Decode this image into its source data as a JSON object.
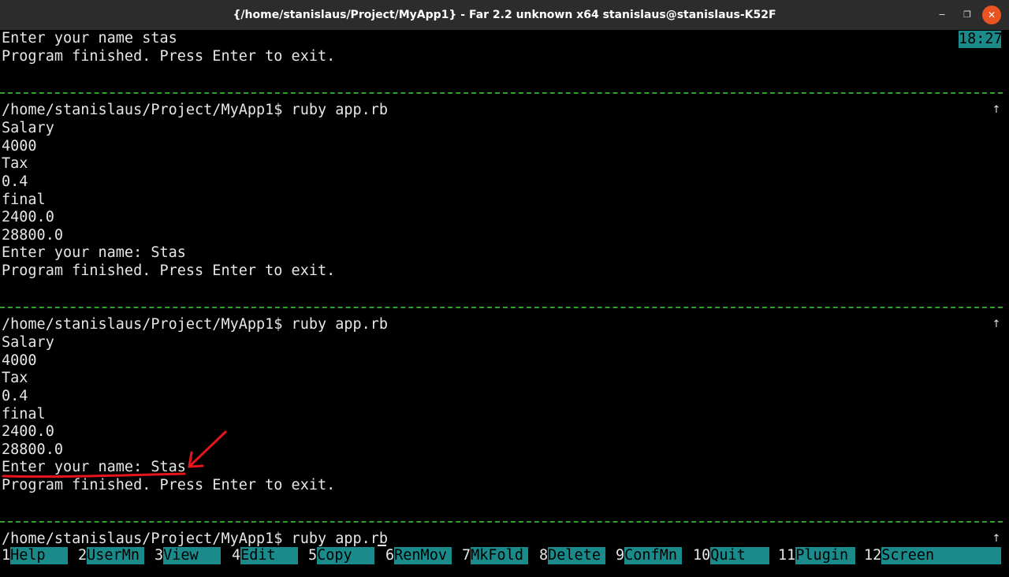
{
  "window": {
    "title": "{/home/stanislaus/Project/MyApp1} - Far 2.2 unknown x64 stanislaus@stanislaus-K52F",
    "minimize_glyph": "‒",
    "maximize_glyph": "❐",
    "close_glyph": "✕"
  },
  "clock": "18:27",
  "console": {
    "lines": [
      "Enter your name stas",
      "Program finished. Press Enter to exit.",
      "/home/stanislaus/Project/MyApp1$ ruby app.rb",
      "Salary",
      "4000",
      "Tax",
      "0.4",
      "final",
      "2400.0",
      "28800.0",
      "Enter your name: Stas",
      "Program finished. Press Enter to exit.",
      "/home/stanislaus/Project/MyApp1$ ruby app.rb",
      "Salary",
      "4000",
      "Tax",
      "0.4",
      "final",
      "2400.0",
      "28800.0",
      "Enter your name: Stas",
      "Program finished. Press Enter to exit.",
      "/home/stanislaus/Project/MyApp1$ ruby app.rb"
    ],
    "scroll_marker": "↑"
  },
  "keybar": [
    {
      "num": "1",
      "label": "Help"
    },
    {
      "num": "2",
      "label": "UserMn"
    },
    {
      "num": "3",
      "label": "View"
    },
    {
      "num": "4",
      "label": "Edit"
    },
    {
      "num": "5",
      "label": "Copy"
    },
    {
      "num": "6",
      "label": "RenMov"
    },
    {
      "num": "7",
      "label": "MkFold"
    },
    {
      "num": "8",
      "label": "Delete"
    },
    {
      "num": "9",
      "label": "ConfMn"
    },
    {
      "num": "10",
      "label": "Quit"
    },
    {
      "num": "11",
      "label": "Plugin"
    },
    {
      "num": "12",
      "label": "Screen"
    }
  ],
  "colors": {
    "titlebar_bg": "#2c2c2c",
    "terminal_bg": "#000000",
    "terminal_fg": "#e6e6e6",
    "separator": "#2e9e2e",
    "keybar_bg": "#1a8a8a",
    "close_button": "#e95420",
    "annotation": "#e8141c"
  },
  "annotation_icon": "red-arrow-pointing-to-line"
}
